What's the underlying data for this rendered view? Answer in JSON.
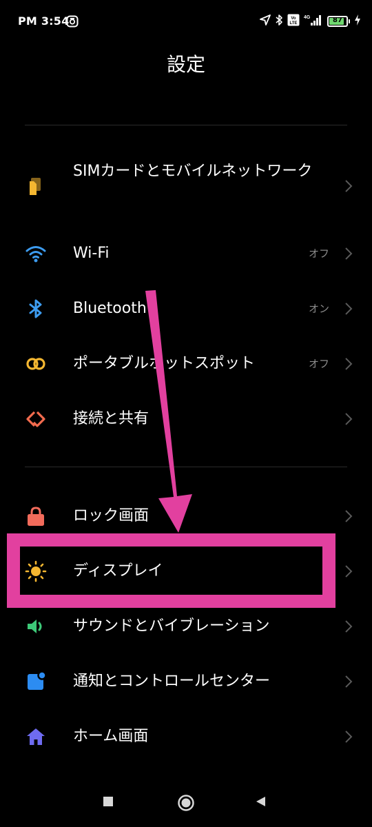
{
  "status_bar": {
    "time": "PM 3:54",
    "battery_level": 87,
    "battery_text": "87",
    "icons": [
      "notification-app-icon",
      "location-arrow-icon",
      "bluetooth-icon",
      "volte-icon",
      "mobile-signal-4g-icon",
      "battery-icon",
      "charging-bolt-icon"
    ]
  },
  "header": {
    "title": "設定"
  },
  "sections": [
    {
      "items": [
        {
          "label": "SIMカードとモバイルネットワーク",
          "status": "",
          "icon": "sim-card-icon",
          "icon_color": "#F5B731"
        },
        {
          "label": "Wi-Fi",
          "status": "オフ",
          "icon": "wifi-icon",
          "icon_color": "#3D9CF0"
        },
        {
          "label": "Bluetooth",
          "status": "オン",
          "icon": "bluetooth-icon",
          "icon_color": "#3D9CF0"
        },
        {
          "label": "ポータブルホットスポット",
          "status": "オフ",
          "icon": "hotspot-icon",
          "icon_color": "#F5B731"
        },
        {
          "label": "接続と共有",
          "status": "",
          "icon": "connection-sharing-icon",
          "icon_color": "#F26B4E"
        }
      ]
    },
    {
      "items": [
        {
          "label": "ロック画面",
          "status": "",
          "icon": "lock-icon",
          "icon_color": "#F26B5B"
        },
        {
          "label": "ディスプレイ",
          "status": "",
          "icon": "display-brightness-icon",
          "icon_color": "#F5B731"
        },
        {
          "label": "サウンドとバイブレーション",
          "status": "",
          "icon": "sound-icon",
          "icon_color": "#3DC978"
        },
        {
          "label": "通知とコントロールセンター",
          "status": "",
          "icon": "notification-icon",
          "icon_color": "#2C8CF2"
        },
        {
          "label": "ホーム画面",
          "status": "",
          "icon": "home-icon",
          "icon_color": "#6E6BF0"
        }
      ]
    }
  ],
  "annotation": {
    "color": "#E2409F",
    "highlighted_item": "ディスプレイ"
  },
  "nav_bar": {
    "buttons": [
      "recents-icon",
      "home-circle-icon",
      "back-icon"
    ]
  }
}
